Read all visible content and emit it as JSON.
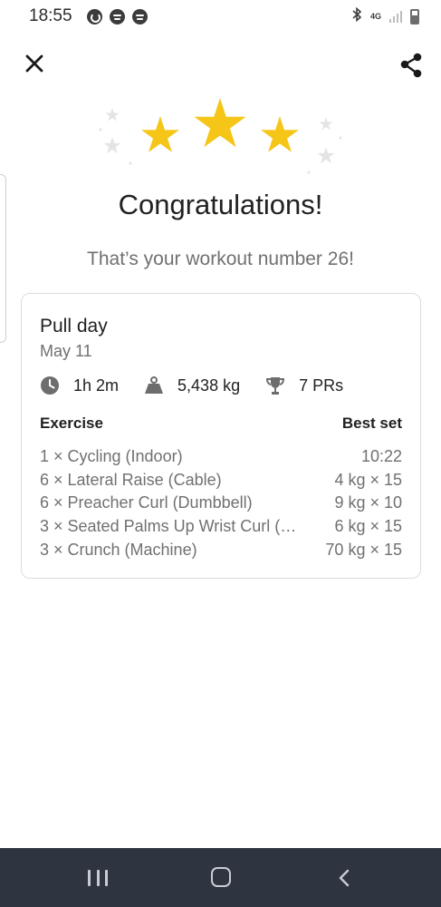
{
  "status_bar": {
    "time": "18:55",
    "network_label": "4G",
    "icons": [
      "sync-app-icon",
      "spotify-icon",
      "spotify-icon",
      "bluetooth-icon",
      "signal-icon",
      "battery-icon"
    ]
  },
  "header": {
    "close_icon": "close-icon",
    "share_icon": "share-icon"
  },
  "celebration": {
    "title": "Congratulations!",
    "subtitle": "That’s your workout number 26!",
    "star_color": "#F5C518"
  },
  "workout": {
    "title": "Pull day",
    "date": "May 11",
    "stats": {
      "duration": "1h 2m",
      "volume": "5,438 kg",
      "prs": "7 PRs"
    },
    "table": {
      "exercise_header": "Exercise",
      "best_set_header": "Best set",
      "rows": [
        {
          "exercise": "1 × Cycling (Indoor)",
          "best_set": "10:22"
        },
        {
          "exercise": "6 × Lateral Raise (Cable)",
          "best_set": "4 kg × 15"
        },
        {
          "exercise": "6 × Preacher Curl (Dumbbell)",
          "best_set": "9 kg × 10"
        },
        {
          "exercise": "3 × Seated Palms Up Wrist Curl (…",
          "best_set": "6 kg × 15"
        },
        {
          "exercise": "3 × Crunch (Machine)",
          "best_set": "70 kg × 15"
        }
      ]
    }
  },
  "nav_bar": {
    "icons": [
      "recent-apps-icon",
      "home-icon",
      "back-icon"
    ]
  }
}
